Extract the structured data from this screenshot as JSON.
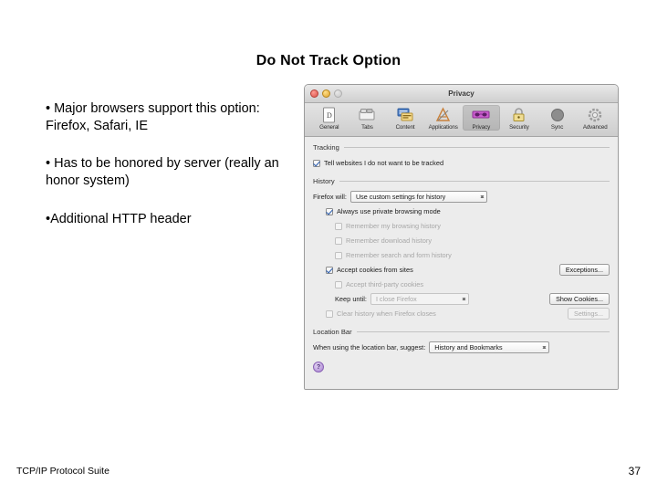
{
  "slide": {
    "title": "Do Not Track Option",
    "bullets": [
      "• Major browsers support this option: Firefox, Safari, IE",
      "• Has to be honored by server (really an honor system)",
      "•Additional HTTP header"
    ],
    "footer": "TCP/IP Protocol Suite",
    "page_number": "37"
  },
  "prefs_window": {
    "title": "Privacy",
    "traffic_lights": [
      "close-button",
      "minimize-button",
      "zoom-button"
    ],
    "toolbar": [
      {
        "label": "General",
        "icon": "document-icon",
        "selected": false
      },
      {
        "label": "Tabs",
        "icon": "tabs-icon",
        "selected": false
      },
      {
        "label": "Content",
        "icon": "content-icon",
        "selected": false
      },
      {
        "label": "Applications",
        "icon": "applications-icon",
        "selected": false
      },
      {
        "label": "Privacy",
        "icon": "mask-icon",
        "selected": true
      },
      {
        "label": "Security",
        "icon": "padlock-icon",
        "selected": false
      },
      {
        "label": "Sync",
        "icon": "sync-icon",
        "selected": false
      },
      {
        "label": "Advanced",
        "icon": "gear-icon",
        "selected": false
      }
    ],
    "tracking": {
      "group_title": "Tracking",
      "do_not_track_label": "Tell websites I do not want to be tracked",
      "do_not_track_checked": true
    },
    "history": {
      "group_title": "History",
      "firefox_will_label": "Firefox will:",
      "firefox_will_value": "Use custom settings for history",
      "always_private_label": "Always use private browsing mode",
      "always_private_checked": true,
      "remember_browsing_label": "Remember my browsing history",
      "remember_downloads_label": "Remember download history",
      "remember_search_label": "Remember search and form history",
      "accept_cookies_label": "Accept cookies from sites",
      "accept_cookies_checked": true,
      "exceptions_button": "Exceptions...",
      "third_party_label": "Accept third-party cookies",
      "keep_until_label": "Keep until:",
      "keep_until_value": "I close Firefox",
      "show_cookies_button": "Show Cookies...",
      "clear_history_label": "Clear history when Firefox closes",
      "settings_button": "Settings..."
    },
    "location_bar": {
      "group_title": "Location Bar",
      "suggest_label": "When using the location bar, suggest:",
      "suggest_value": "History and Bookmarks"
    },
    "help_button_glyph": "?"
  },
  "colors": {
    "window_bg": "#ececec",
    "checkbox_check": "#2a5db0",
    "privacy_icon": "#cc5fd0",
    "help_button": "#a77fd0"
  }
}
